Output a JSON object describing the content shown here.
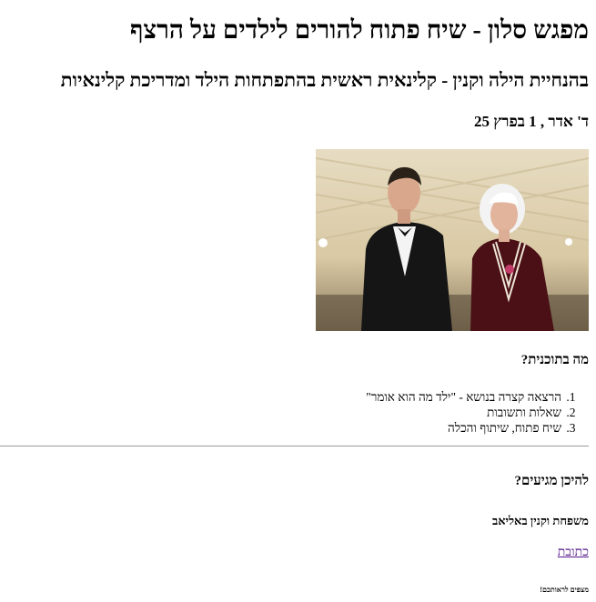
{
  "title": "מפגש סלון - שיח פתוח להורים לילדים על הרצף",
  "subtitle": "בהנחיית הילה וקנין - קלינאית ראשית בהתפתחות הילד ומדריכת קלינאיות",
  "date": "ד' אדר , 1 בפרץ 25",
  "program": {
    "heading": "מה בתוכנית?",
    "items": [
      "הרצאה קצרה בנושא - \"ילד מה הוא אומר\"",
      "שאלות ותשובות",
      "שיח פתוח, שיתוף והכלה"
    ]
  },
  "location": {
    "heading": "להיכן מגיעים?",
    "venue": "משפחת וקנין באליאב",
    "address_link": "כתובת"
  },
  "footnote": "מצפים לראותכם!",
  "colors": {
    "link": "#551a8b",
    "divider": "#9a9a9a"
  }
}
